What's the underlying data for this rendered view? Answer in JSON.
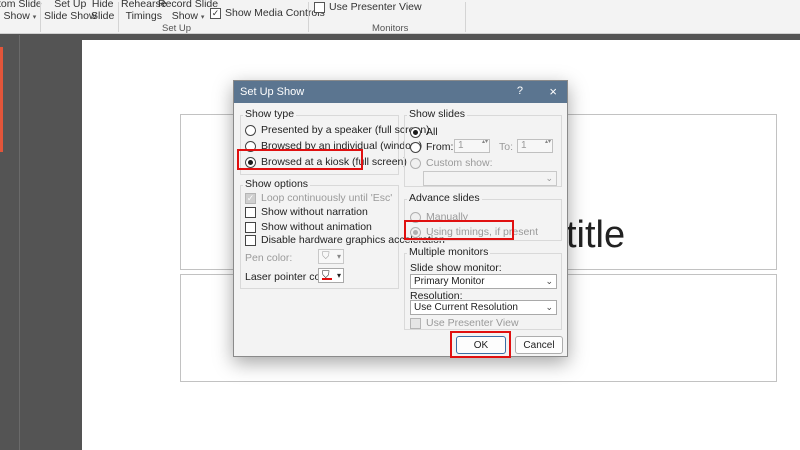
{
  "ribbon": {
    "custom_slide_show": "tom Slide",
    "custom_slide_show_2": "Show",
    "set_up_show_1": "Set Up",
    "set_up_show_2": "Slide Show",
    "hide_slide_1": "Hide",
    "hide_slide_2": "Slide",
    "rehearse_1": "Rehearse",
    "rehearse_2": "Timings",
    "record_1": "Record Slide",
    "record_2": "Show",
    "show_media_controls": "Show Media Controls",
    "use_presenter_view": "Use Presenter View",
    "group_setup": "Set Up",
    "group_monitors": "Monitors"
  },
  "slide": {
    "title_text": "title"
  },
  "dialog": {
    "title": "Set Up Show",
    "help": "?",
    "close": "×",
    "show_type": {
      "label": "Show type",
      "options": [
        "Presented by a speaker (full screen)",
        "Browsed by an individual (window)",
        "Browsed at a kiosk (full screen)"
      ],
      "selected": 2
    },
    "show_options": {
      "label": "Show options",
      "loop": "Loop continuously until 'Esc'",
      "without_narration": "Show without narration",
      "without_animation": "Show without animation",
      "disable_hw": "Disable hardware graphics acceleration",
      "pen_color": "Pen color:",
      "laser_color": "Laser pointer color:",
      "laser_swatch": "#e01010"
    },
    "show_slides": {
      "label": "Show slides",
      "all": "All",
      "from": "From:",
      "from_value": "1",
      "to": "To:",
      "to_value": "1",
      "custom": "Custom show:",
      "custom_value": ""
    },
    "advance_slides": {
      "label": "Advance slides",
      "manually": "Manually",
      "timings": "Using timings, if present"
    },
    "monitors": {
      "label": "Multiple monitors",
      "slide_show_monitor_label": "Slide show monitor:",
      "slide_show_monitor": "Primary Monitor",
      "resolution_label": "Resolution:",
      "resolution": "Use Current Resolution",
      "presenter_view": "Use Presenter View"
    },
    "ok": "OK",
    "cancel": "Cancel"
  },
  "colors": {
    "highlight": "#e01010",
    "title_bar": "#5b7590",
    "accent_tab": "#e2553a"
  }
}
